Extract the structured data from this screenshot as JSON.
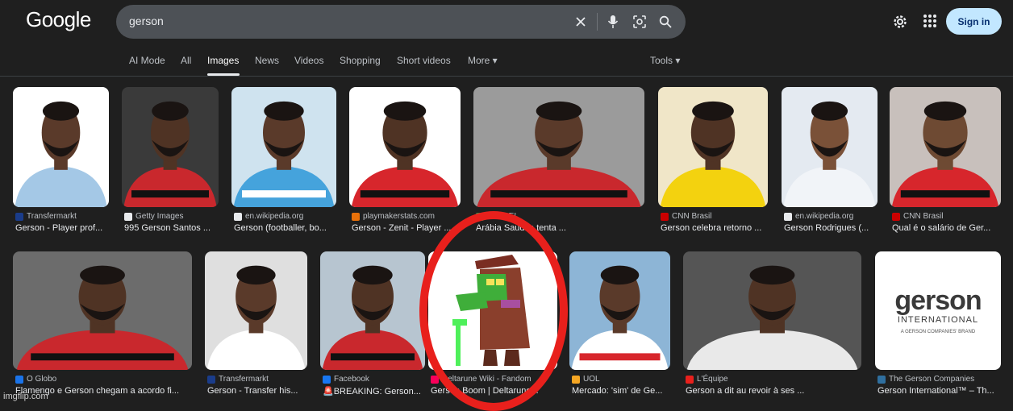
{
  "header": {
    "logo": "Google",
    "search_value": "gerson",
    "sign_in_label": "Sign in",
    "icons": [
      "clear-icon",
      "mic-icon",
      "lens-icon",
      "search-icon",
      "gear-icon",
      "apps-icon"
    ]
  },
  "tabs": [
    {
      "label": "AI Mode"
    },
    {
      "label": "All"
    },
    {
      "label": "Images",
      "active": true
    },
    {
      "label": "News"
    },
    {
      "label": "Videos"
    },
    {
      "label": "Shopping"
    },
    {
      "label": "Short videos"
    },
    {
      "label": "More ▾"
    }
  ],
  "tools_label": "Tools ▾",
  "results": [
    {
      "source": "Transfermarkt",
      "title": "Gerson - Player prof...",
      "fav": "#1a3c8a",
      "bg": "#ffffff"
    },
    {
      "source": "Getty Images",
      "title": "995 Gerson Santos ...",
      "fav": "#e8eaed",
      "bg": "#c43a33"
    },
    {
      "source": "en.wikipedia.org",
      "title": "Gerson (footballer, bo...",
      "fav": "#e8eaed",
      "bg": "#5aa5d8"
    },
    {
      "source": "playmakerstats.com",
      "title": "Gerson - Zenit - Player ...",
      "fav": "#e8710a",
      "bg": "#ffffff"
    },
    {
      "source": "LANCE!",
      "title": "Arábia Saudita tenta ...",
      "fav": "#2c9a4a",
      "bg": "#9b9b9b"
    },
    {
      "source": "CNN Brasil",
      "title": "Gerson celebra retorno ...",
      "fav": "#cc0000",
      "bg": "#f1c500"
    },
    {
      "source": "en.wikipedia.org",
      "title": "Gerson Rodrigues (...",
      "fav": "#e8eaed",
      "bg": "#e8eef5"
    },
    {
      "source": "CNN Brasil",
      "title": "Qual é o salário de Ger...",
      "fav": "#cc0000",
      "bg": "#c8c0bc"
    },
    {
      "source": "O Globo",
      "title": "Flamengo e Gerson chegam a acordo fi...",
      "fav": "#1a73e8",
      "bg": "#6c6c6c"
    },
    {
      "source": "Transfermarkt",
      "title": "Gerson - Transfer his...",
      "fav": "#1a3c8a",
      "bg": "#dfdfdf"
    },
    {
      "source": "Facebook",
      "title": "🚨BREAKING: Gerson...",
      "fav": "#1877f2",
      "bg": "#b7c5d0"
    },
    {
      "source": "Deltarune Wiki - Fandom",
      "title": "Gerson Boom | Deltarune...",
      "fav": "#fa005a",
      "bg": "#ffffff"
    },
    {
      "source": "UOL",
      "title": "Mercado: 'sim' de Ge...",
      "fav": "#f5a623",
      "bg": "#8db5d6"
    },
    {
      "source": "L'Équipe",
      "title": "Gerson a dit au revoir à ses ...",
      "fav": "#e8201c",
      "bg": "#555555"
    },
    {
      "source": "The Gerson Companies",
      "title": "Gerson International™ – Th...",
      "fav": "#2f6f9f",
      "bg": "#ffffff"
    }
  ],
  "gerson_logo": {
    "brand": "gerson",
    "sub": "INTERNATIONAL",
    "tagline": "A GERSON COMPANIES' BRAND"
  },
  "watermark": "imgflip.com"
}
